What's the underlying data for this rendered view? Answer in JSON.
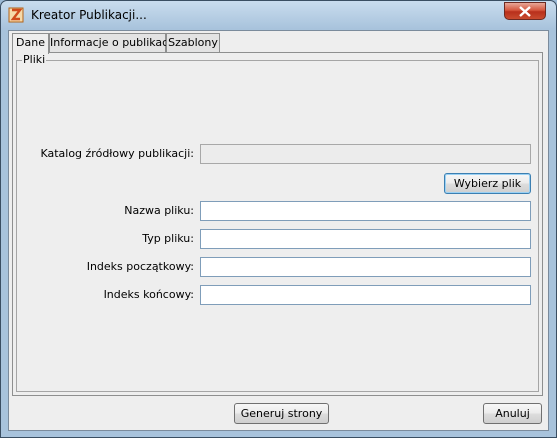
{
  "window": {
    "title": "Kreator Publikacji..."
  },
  "tabs": [
    {
      "label": "Dane",
      "active": true
    },
    {
      "label": "Informacje o publikacji",
      "active": false
    },
    {
      "label": "Szablony",
      "active": false
    }
  ],
  "panel": {
    "group_label": "Pliki",
    "source_dir_label": "Katalog źródłowy publikacji:",
    "source_dir_value": "",
    "choose_file_button": "Wybierz plik",
    "file_name_label": "Nazwa pliku:",
    "file_name_value": "",
    "file_type_label": "Typ pliku:",
    "file_type_value": "",
    "start_index_label": "Indeks początkowy:",
    "start_index_value": "",
    "end_index_label": "Indeks końcowy:",
    "end_index_value": ""
  },
  "footer": {
    "generate_button": "Generuj strony",
    "cancel_button": "Anuluj"
  },
  "colors": {
    "title_bar": "#a8c3dc",
    "close_button": "#c94b2f",
    "focus_border": "#3c7fb1"
  },
  "icons": {
    "app": "app-logo-icon",
    "close": "close-icon"
  }
}
